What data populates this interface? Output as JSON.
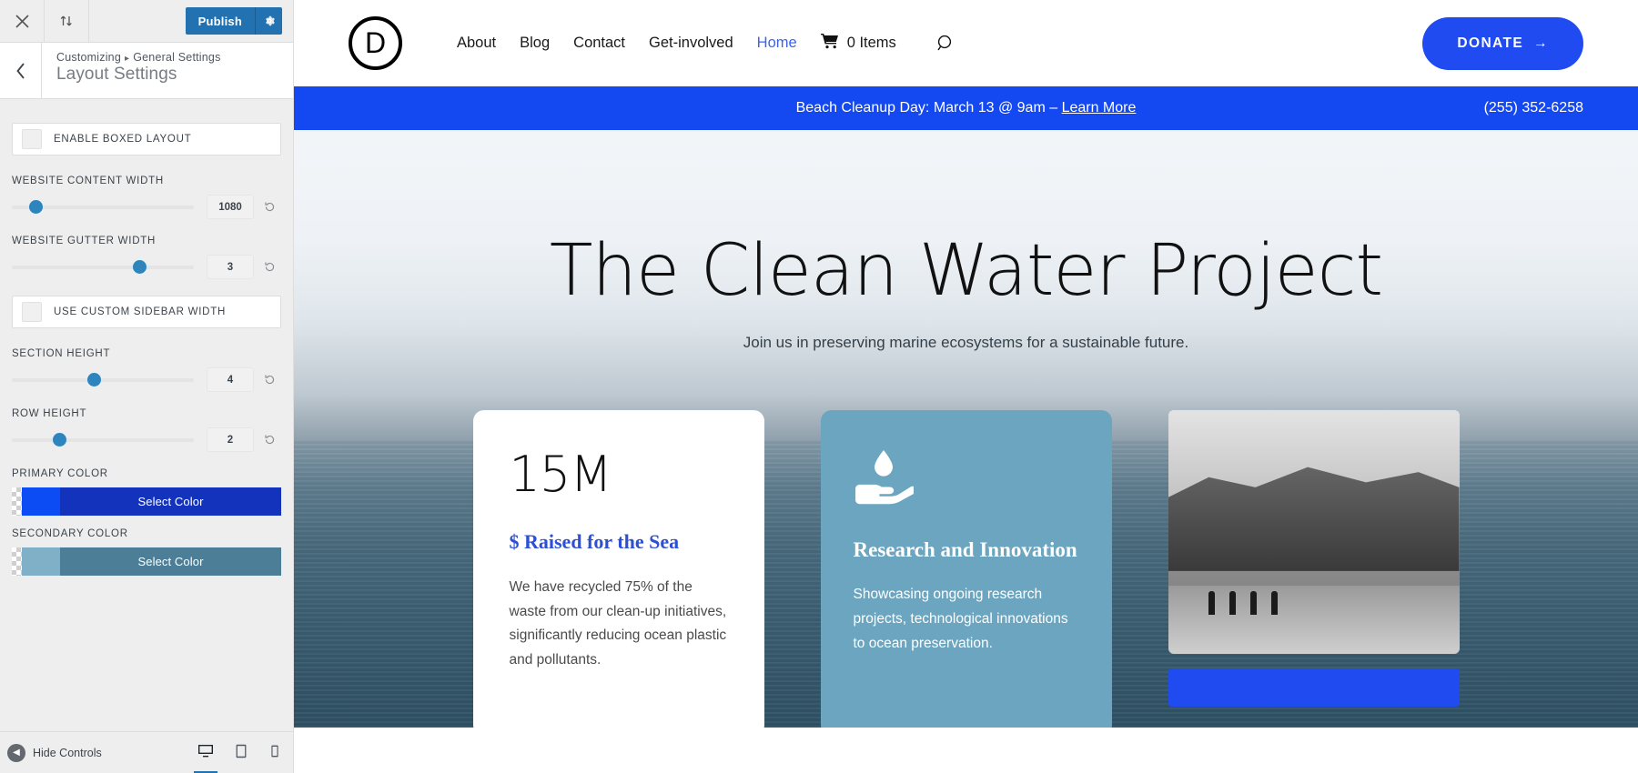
{
  "customizer": {
    "topbar": {
      "close_icon": "close-icon",
      "reorder_icon": "up-down-arrows-icon",
      "publish_label": "Publish",
      "gear_icon": "gear-icon"
    },
    "header": {
      "back_icon": "chevron-left-icon",
      "breadcrumb_root": "Customizing",
      "breadcrumb_separator": "▸",
      "breadcrumb_parent": "General Settings",
      "panel_title": "Layout Settings"
    },
    "controls": [
      {
        "type": "toggle",
        "label": "ENABLE BOXED LAYOUT",
        "checked": false
      },
      {
        "type": "slider",
        "label": "WEBSITE CONTENT WIDTH",
        "value": "1080",
        "percent": 9
      },
      {
        "type": "slider",
        "label": "WEBSITE GUTTER WIDTH",
        "value": "3",
        "percent": 62
      },
      {
        "type": "toggle",
        "label": "USE CUSTOM SIDEBAR WIDTH",
        "checked": false
      },
      {
        "type": "slider",
        "label": "SECTION HEIGHT",
        "value": "4",
        "percent": 39
      },
      {
        "type": "slider",
        "label": "ROW HEIGHT",
        "value": "2",
        "percent": 21
      }
    ],
    "colors": [
      {
        "label": "PRIMARY COLOR",
        "button_label": "Select Color",
        "swatch": "#0b4cf5",
        "button_bg": "#1433bd"
      },
      {
        "label": "SECONDARY COLOR",
        "button_label": "Select Color",
        "swatch": "#7fb0c8",
        "button_bg": "#4c7f97"
      }
    ],
    "footer": {
      "hide_controls_label": "Hide Controls",
      "collapse_icon": "chevron-left-circle-icon",
      "devices": [
        {
          "name": "desktop-icon",
          "active": true
        },
        {
          "name": "tablet-icon",
          "active": false
        },
        {
          "name": "mobile-icon",
          "active": false
        }
      ]
    },
    "accent_color": "#2271b1"
  },
  "site": {
    "logo": {
      "letter": "D",
      "name": "divi-logo"
    },
    "nav": [
      {
        "label": "About",
        "current": false
      },
      {
        "label": "Blog",
        "current": false
      },
      {
        "label": "Contact",
        "current": false
      },
      {
        "label": "Get-involved",
        "current": false
      },
      {
        "label": "Home",
        "current": true
      }
    ],
    "cart": {
      "icon": "shopping-cart-icon",
      "label": "0 Items"
    },
    "search_icon": "search-icon",
    "donate": {
      "label": "DONATE",
      "arrow": "→",
      "color": "#1f4bf0"
    },
    "announcement": {
      "text": "Beach Cleanup Day: March 13 @ 9am – ",
      "link_label": "Learn More",
      "phone": "(255) 352-6258",
      "bg": "#1448f0"
    },
    "hero": {
      "title": "The Clean Water Project",
      "subtitle": "Join us in preserving marine ecosystems for a sustainable future."
    },
    "cards": [
      {
        "kind": "stat",
        "number": "15M",
        "heading": "$ Raised for the Sea",
        "heading_color": "#2c4fd6",
        "body": "We have recycled 75% of the waste from our clean-up initiatives, significantly reducing ocean plastic and pollutants."
      },
      {
        "kind": "icon",
        "icon": "hand-holding-water-drop-icon",
        "heading": "Research and Innovation",
        "body": "Showcasing ongoing research projects, technological innovations to ocean preservation.",
        "bg": "#6ba5bf"
      },
      {
        "kind": "photo",
        "image_alt": "black-and-white-beach-with-people-photo"
      }
    ]
  }
}
